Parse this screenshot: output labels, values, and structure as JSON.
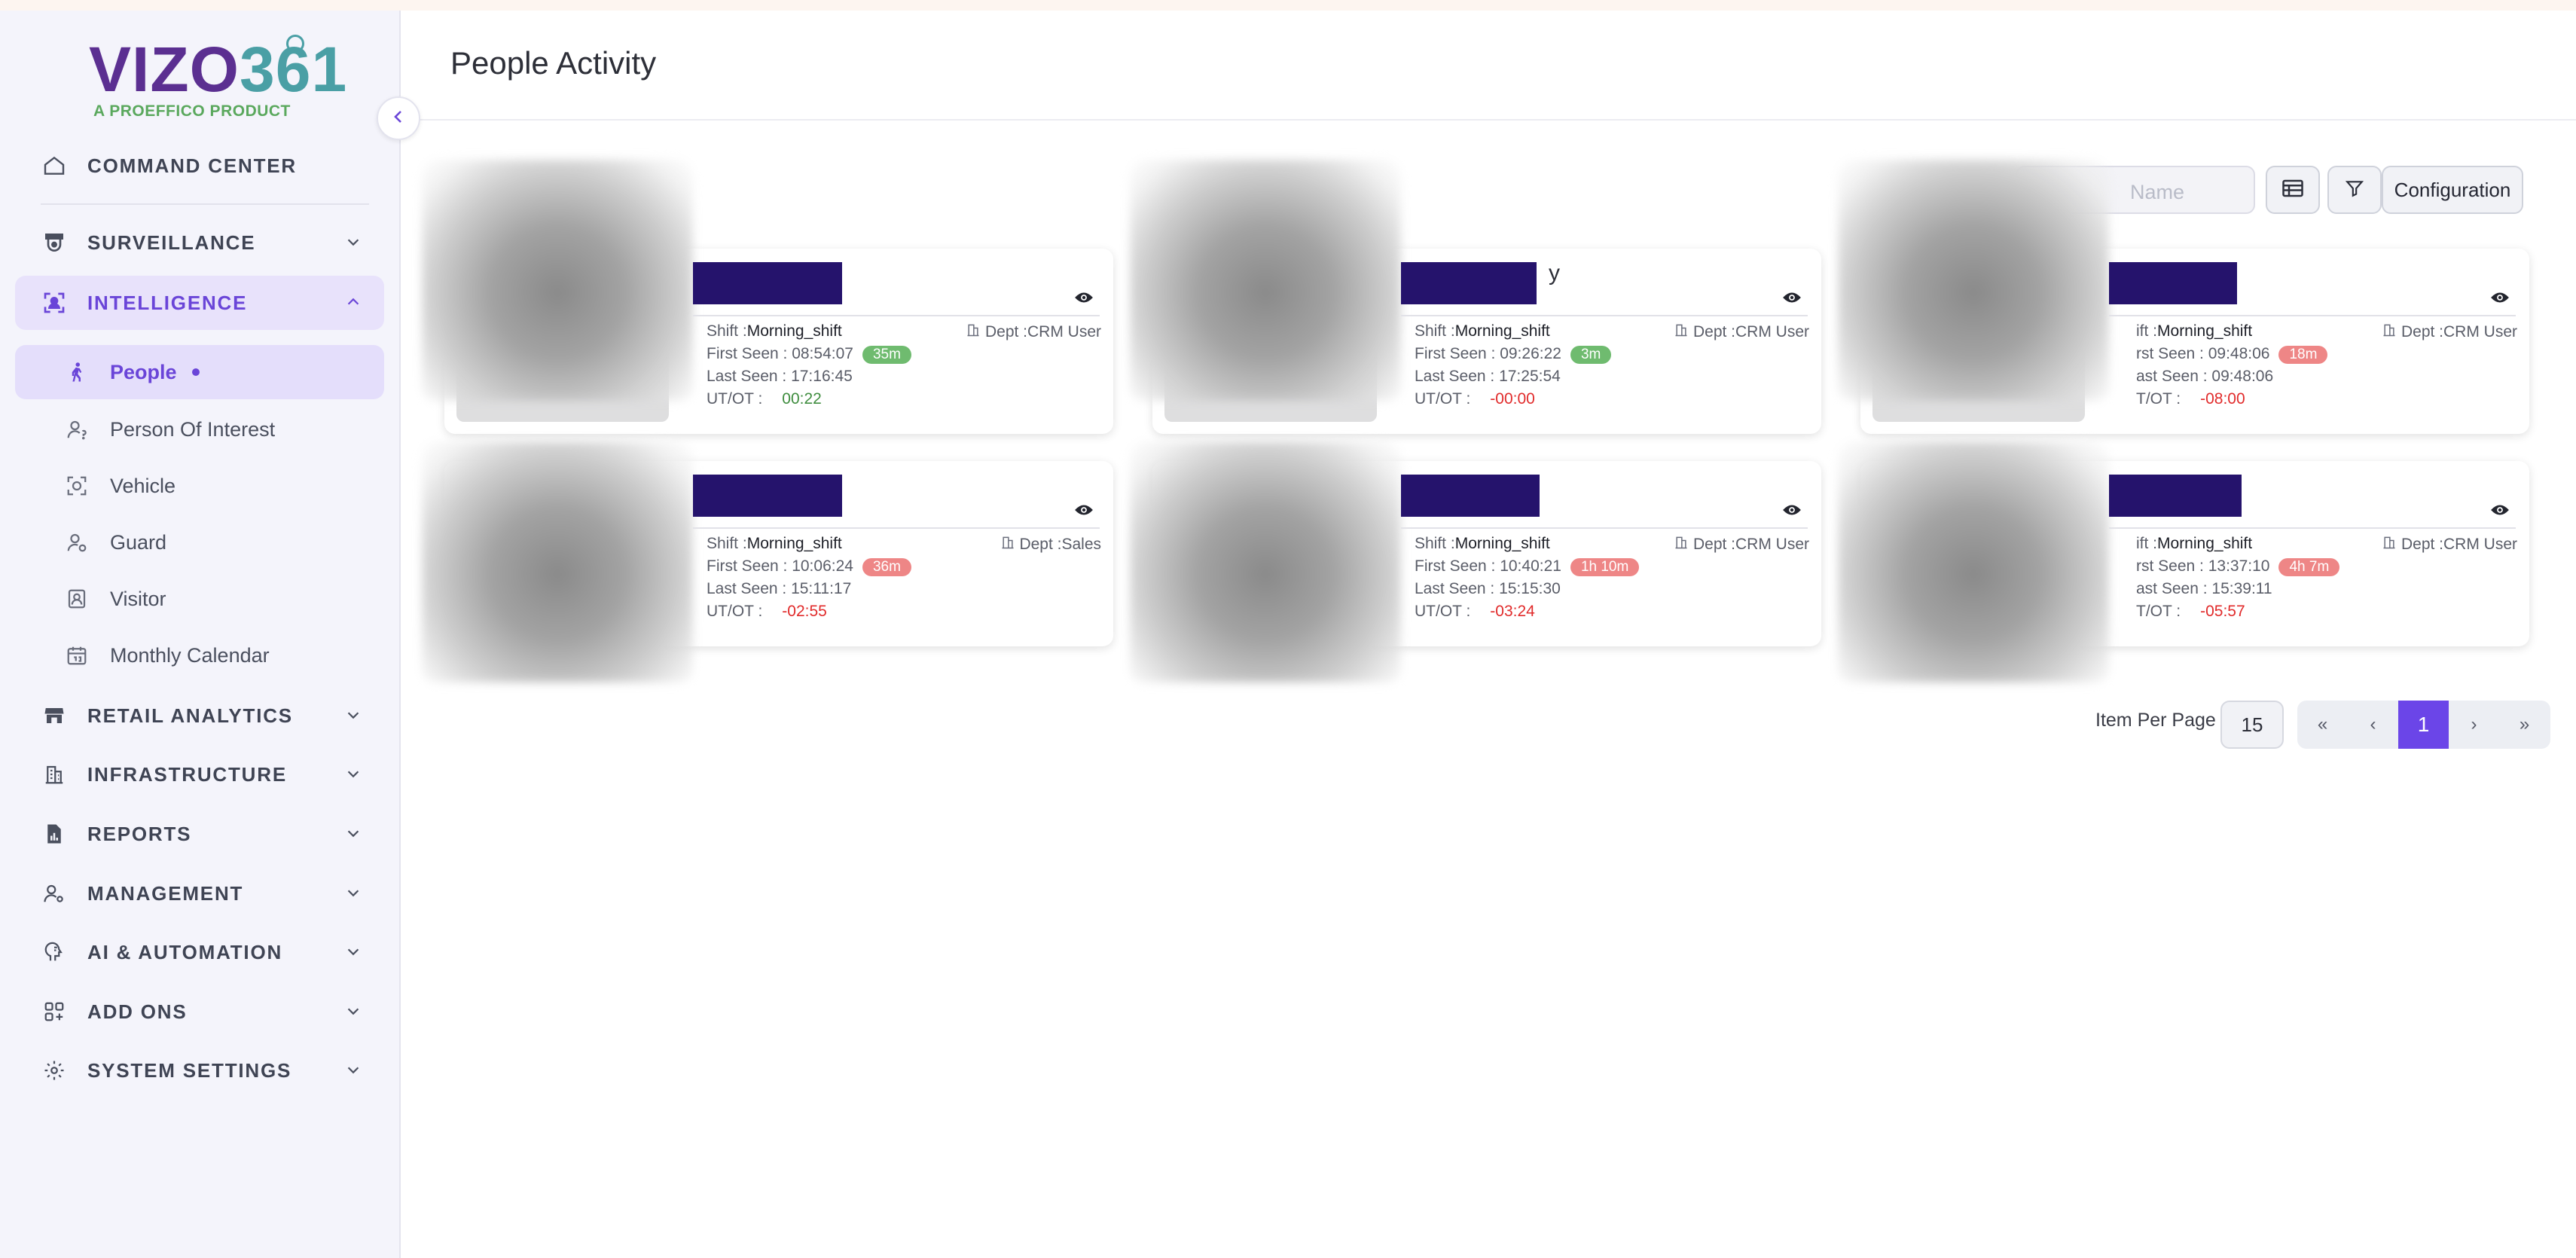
{
  "brand": {
    "logo_main_a": "VIZO",
    "logo_main_b": "361",
    "logo_sub": "A PROEFFICO PRODUCT"
  },
  "sidebar": {
    "command_center": "COMMAND CENTER",
    "groups": [
      {
        "label": "SURVEILLANCE",
        "icon": "camera-icon"
      },
      {
        "label": "INTELLIGENCE",
        "icon": "scan-face-icon",
        "expanded": true
      },
      {
        "label": "RETAIL ANALYTICS",
        "icon": "store-icon"
      },
      {
        "label": "INFRASTRUCTURE",
        "icon": "building-icon"
      },
      {
        "label": "REPORTS",
        "icon": "report-icon"
      },
      {
        "label": "MANAGEMENT",
        "icon": "user-settings-icon"
      },
      {
        "label": "AI & AUTOMATION",
        "icon": "ai-brain-icon"
      },
      {
        "label": "ADD ONS",
        "icon": "grid-plus-icon"
      },
      {
        "label": "SYSTEM SETTINGS",
        "icon": "gear-icon"
      }
    ],
    "intelligence_items": [
      {
        "label": "People",
        "icon": "walking-person-icon",
        "active": true
      },
      {
        "label": "Person Of Interest",
        "icon": "person-question-icon"
      },
      {
        "label": "Vehicle",
        "icon": "vehicle-scan-icon"
      },
      {
        "label": "Guard",
        "icon": "guard-icon"
      },
      {
        "label": "Visitor",
        "icon": "visitor-badge-icon"
      },
      {
        "label": "Monthly Calendar",
        "icon": "calendar-icon"
      }
    ]
  },
  "header": {
    "title": "People Activity"
  },
  "toolbar": {
    "search_placeholder": "Name",
    "config_label": "Configuration"
  },
  "colors": {
    "accent": "#6b45e8",
    "name_bar": "#25136c",
    "good": "#6fbb6f",
    "bad": "#ee8686"
  },
  "cards": [
    {
      "shift_label": "Shift :",
      "shift": "Morning_shift",
      "dept": "Dept :CRM User",
      "first_label": "First Seen : ",
      "first": "08:54:07",
      "badge": "35m",
      "badge_color": "green",
      "last_label": "Last Seen : ",
      "last": "17:16:45",
      "utot_label": "UT/OT :",
      "utot": "00:22",
      "utot_color": "green"
    },
    {
      "shift_label": "Shift :",
      "shift": "Morning_shift",
      "dept": "Dept :CRM User",
      "first_label": "First Seen : ",
      "first": "09:26:22",
      "badge": "3m",
      "badge_color": "green",
      "last_label": "Last Seen : ",
      "last": "17:25:54",
      "utot_label": "UT/OT :",
      "utot": "-00:00",
      "utot_color": "red"
    },
    {
      "shift_label": "ift :",
      "shift": "Morning_shift",
      "dept": "Dept :CRM User",
      "first_label": "rst Seen : ",
      "first": "09:48:06",
      "badge": "18m",
      "badge_color": "red",
      "last_label": "ast Seen : ",
      "last": "09:48:06",
      "utot_label": "T/OT :",
      "utot": "-08:00",
      "utot_color": "red"
    },
    {
      "shift_label": "Shift :",
      "shift": "Morning_shift",
      "dept": "Dept :Sales",
      "first_label": "First Seen : ",
      "first": "10:06:24",
      "badge": "36m",
      "badge_color": "red",
      "last_label": "Last Seen : ",
      "last": "15:11:17",
      "utot_label": "UT/OT :",
      "utot": "-02:55",
      "utot_color": "red"
    },
    {
      "shift_label": "Shift :",
      "shift": "Morning_shift",
      "dept": "Dept :CRM User",
      "first_label": "First Seen : ",
      "first": "10:40:21",
      "badge": "1h 10m",
      "badge_color": "red",
      "last_label": "Last Seen : ",
      "last": "15:15:30",
      "utot_label": "UT/OT :",
      "utot": "-03:24",
      "utot_color": "red"
    },
    {
      "shift_label": "ift :",
      "shift": "Morning_shift",
      "dept": "Dept :CRM User",
      "first_label": "rst Seen : ",
      "first": "13:37:10",
      "badge": "4h 7m",
      "badge_color": "red",
      "last_label": "ast Seen : ",
      "last": "15:39:11",
      "utot_label": "T/OT :",
      "utot": "-05:57",
      "utot_color": "red"
    }
  ],
  "card_fragment": "y",
  "pagination": {
    "items_per_page_label": "Item Per Page",
    "items_per_page": "15",
    "first": "«",
    "prev": "‹",
    "current": "1",
    "next": "›",
    "last": "»"
  }
}
